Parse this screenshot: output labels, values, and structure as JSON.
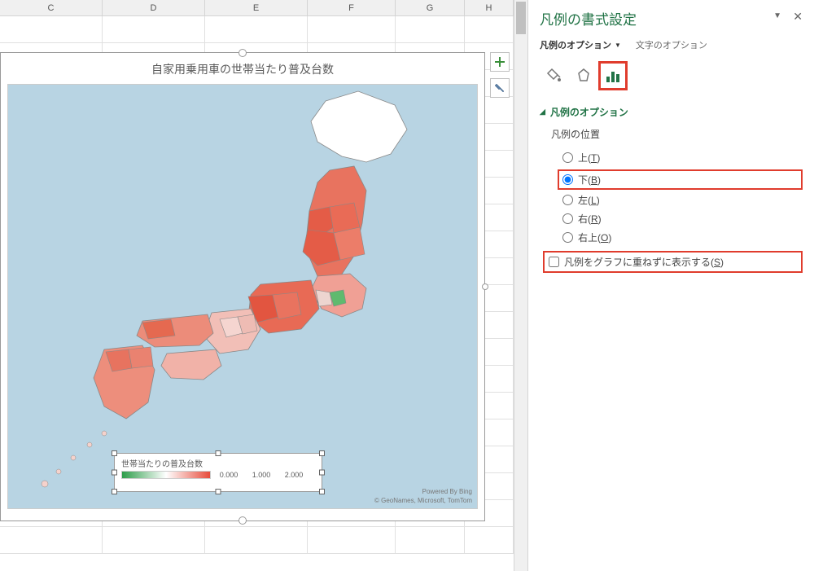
{
  "columns": [
    "C",
    "D",
    "E",
    "F",
    "G",
    "H"
  ],
  "chart": {
    "title": "自家用乗用車の世帯当たり普及台数",
    "attribution_line1": "Powered By Bing",
    "attribution_line2": "© GeoNames, Microsoft, TomTom",
    "legend": {
      "label": "世帯当たりの普及台数",
      "values": [
        "0.000",
        "1.000",
        "2.000"
      ]
    },
    "plus_tooltip": "+",
    "brush_tooltip": "ブラシ"
  },
  "panel": {
    "title": "凡例の書式設定",
    "tab_options": "凡例のオプション",
    "tab_text": "文字のオプション",
    "section_title": "凡例のオプション",
    "position_label": "凡例の位置",
    "radios": {
      "top": "上(T)",
      "bottom": "下(B)",
      "left": "左(L)",
      "right": "右(R)",
      "topright": "右上(O)"
    },
    "overlap_checkbox": "凡例をグラフに重ねずに表示する(S)"
  },
  "chart_data": {
    "type": "map",
    "region": "Japan prefectures",
    "metric": "世帯当たりの普及台数",
    "color_scale": {
      "min": 0.0,
      "mid": 1.0,
      "max": 2.0,
      "min_color": "#2d9d4a",
      "mid_color": "#ffffff",
      "max_color": "#e74c3c"
    },
    "note": "Choropleth map; prefecture-level values shown as color; Tokyo area appears green (low), Tohoku/Hokuriku red (high)."
  }
}
